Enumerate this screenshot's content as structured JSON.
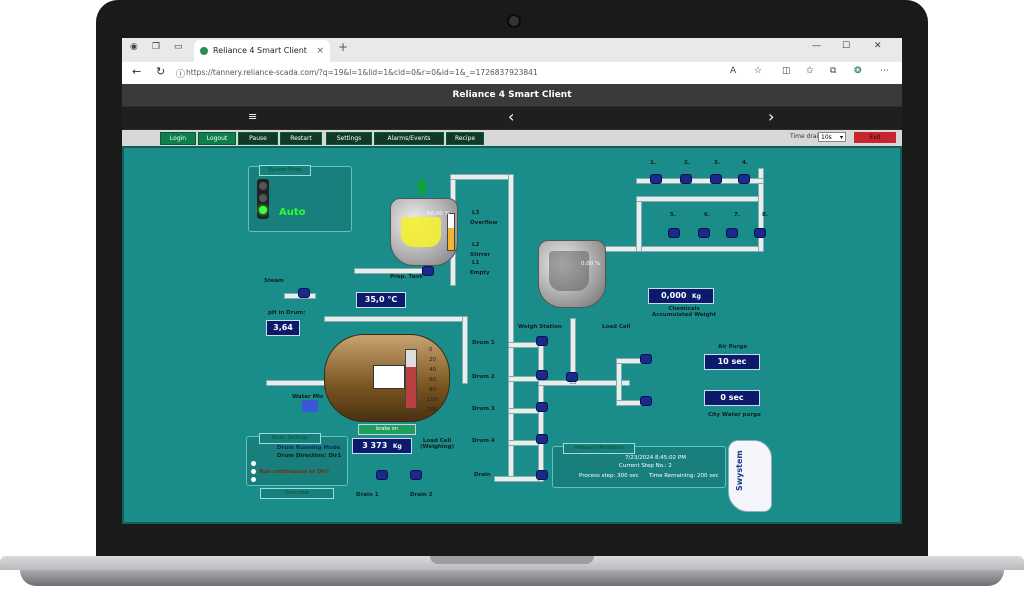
{
  "browser": {
    "tab_title": "Reliance 4 Smart Client",
    "tab_close": "×",
    "new_tab": "+",
    "url": "https://tannery.reliance-scada.com/?q=19&l=1&lid=1&cid=0&r=0&id=1&_=1726837923841",
    "back": "←",
    "reload": "↻",
    "minimize": "—",
    "maximize": "☐",
    "close": "✕"
  },
  "app": {
    "title": "Reliance 4 Smart Client",
    "menu_glyph": "≡",
    "prev_glyph": "‹",
    "next_glyph": "›",
    "toolbar": {
      "buttons": [
        "Login",
        "Logout",
        "Pause",
        "Restart",
        "Settings",
        "Alarms/Events",
        "Recipe"
      ],
      "time_drain_label": "Time drain:",
      "time_drain_value": "10s",
      "exit": "Exit"
    }
  },
  "scada": {
    "system_mode": {
      "title": "System Mode",
      "value": "Auto"
    },
    "prep_tank": {
      "label": "Prep. Tank",
      "level": "60,00 %",
      "l3": "L3",
      "overflow": "Overflow",
      "l2": "L2",
      "stirrer": "Stirrer",
      "l1": "L1",
      "empty": "Empty"
    },
    "weigh_station": {
      "label": "Weigh Station",
      "level": "0,00 %",
      "load_cell": "Load Cell"
    },
    "steam": "Steam",
    "temperature": "35,0 °C",
    "ph": {
      "label": "pH in Drum:",
      "value": "3,64"
    },
    "water_mix": "Water Mix",
    "drum_scale": [
      "0",
      "20",
      "40",
      "60",
      "80",
      "100",
      "200"
    ],
    "drum_weight": {
      "value": "3 373",
      "unit": "Kg"
    },
    "load_cell_weighing": "Load Cell\n(Weighing)",
    "brake_on": "brake on",
    "drums": [
      "Drum 1",
      "Drum 2",
      "Drum 3",
      "Drum 4",
      "Drain"
    ],
    "drain1": "Drain 1",
    "drain2": "Drain 2",
    "drum_settings": {
      "title": "Drum Settings",
      "line1": "Drum Running Mode",
      "line2": "Drum Direction: Dir1",
      "question": "Run continuous in Dir?",
      "overview": "Overview"
    },
    "chemicals": {
      "value": "0,000",
      "unit": "Kg",
      "label": "Chemicals\nAccumulated Weight"
    },
    "dosers": [
      "1.",
      "2.",
      "3.",
      "4.",
      "5.",
      "6.",
      "7.",
      "8."
    ],
    "air_purge": {
      "label": "Air Purge",
      "value": "10 sec"
    },
    "city_water": {
      "label": "City Water purge",
      "value": "0 sec"
    },
    "process_info": {
      "title": "Process information",
      "datetime": "7/23/2024 8:45:02 PM",
      "step": "Current Step No.: 2",
      "process_step": "Process step: 300 sec",
      "time_remaining": "Time Remaining: 200 sec"
    },
    "logo": "Swystem"
  }
}
